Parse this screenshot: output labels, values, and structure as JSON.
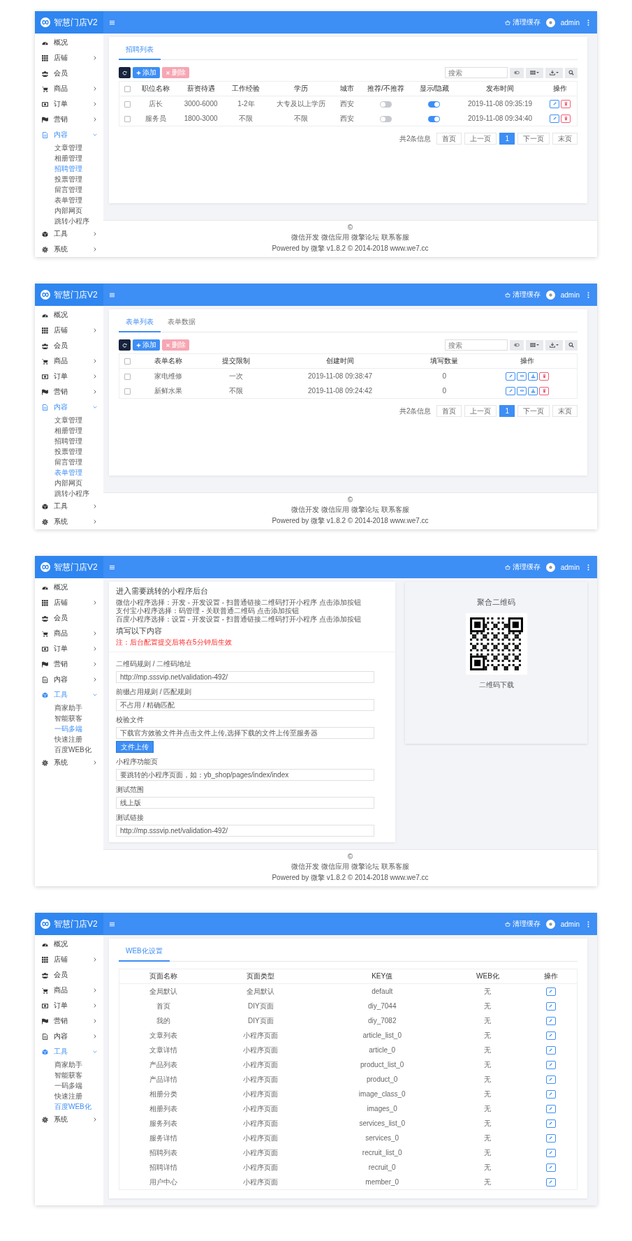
{
  "panels": [
    {
      "header": {
        "title": "智慧门店V2",
        "clear_cache": "清理缓存",
        "user": "admin"
      },
      "sidebar": [
        {
          "label": "概况",
          "kind": "link"
        },
        {
          "label": "店铺",
          "kind": "group",
          "expanded": false
        },
        {
          "label": "会员",
          "kind": "link"
        },
        {
          "label": "商品",
          "kind": "group",
          "expanded": false
        },
        {
          "label": "订单",
          "kind": "group",
          "expanded": false
        },
        {
          "label": "营销",
          "kind": "group",
          "expanded": false
        },
        {
          "label": "内容",
          "kind": "group",
          "expanded": true,
          "children": [
            {
              "label": "文章管理",
              "selected": false
            },
            {
              "label": "相册管理",
              "selected": false
            },
            {
              "label": "招聘管理",
              "selected": true
            },
            {
              "label": "投票管理",
              "selected": false
            },
            {
              "label": "留言管理",
              "selected": false
            },
            {
              "label": "表单管理",
              "selected": false
            },
            {
              "label": "内部网页",
              "selected": false
            },
            {
              "label": "跳转小程序",
              "selected": false
            }
          ]
        },
        {
          "label": "工具",
          "kind": "group",
          "expanded": false
        },
        {
          "label": "系统",
          "kind": "group",
          "expanded": false
        }
      ],
      "content": {
        "kind": "list",
        "tabs": [
          {
            "label": "招聘列表",
            "selected": true
          }
        ],
        "toolbar": {
          "buttons": [
            {
              "kind": "refresh",
              "disabled": false
            },
            {
              "kind": "add",
              "label": "添加",
              "disabled": false
            },
            {
              "kind": "delete",
              "label": "删除",
              "disabled": true
            }
          ],
          "search": {
            "placeholder": "搜索"
          },
          "tools": [
            {
              "kind": "toggle"
            },
            {
              "kind": "columns"
            },
            {
              "kind": "export"
            },
            {
              "kind": "search"
            }
          ]
        },
        "table": {
          "header_checked": false,
          "columns": [
            "职位名称",
            "薪资待遇",
            "工作经验",
            "学历",
            "城市",
            "推荐/不推荐",
            "显示/隐藏",
            "发布时间",
            "操作"
          ],
          "rows": [
            {
              "checked": false,
              "cells": [
                {
                  "kind": "text",
                  "text": "店长"
                },
                {
                  "kind": "text",
                  "text": "3000-6000"
                },
                {
                  "kind": "text",
                  "text": "1-2年"
                },
                {
                  "kind": "text",
                  "text": "大专及以上学历"
                },
                {
                  "kind": "text",
                  "text": "西安"
                },
                {
                  "kind": "toggle",
                  "on": false
                },
                {
                  "kind": "toggle",
                  "on": true
                },
                {
                  "kind": "text",
                  "text": "2019-11-08 09:35:19"
                },
                {
                  "kind": "actions",
                  "actions": [
                    {
                      "kind": "edit"
                    },
                    {
                      "kind": "delete"
                    }
                  ]
                }
              ]
            },
            {
              "checked": false,
              "cells": [
                {
                  "kind": "text",
                  "text": "服务员"
                },
                {
                  "kind": "text",
                  "text": "1800-3000"
                },
                {
                  "kind": "text",
                  "text": "不限"
                },
                {
                  "kind": "text",
                  "text": "不限"
                },
                {
                  "kind": "text",
                  "text": "西安"
                },
                {
                  "kind": "toggle",
                  "on": false
                },
                {
                  "kind": "toggle",
                  "on": true
                },
                {
                  "kind": "text",
                  "text": "2019-11-08 09:34:40"
                },
                {
                  "kind": "actions",
                  "actions": [
                    {
                      "kind": "edit"
                    },
                    {
                      "kind": "delete"
                    }
                  ]
                }
              ]
            }
          ]
        },
        "pagination": {
          "summary": "共2条信息",
          "pages": [
            {
              "label": "首页",
              "selected": false
            },
            {
              "label": "上一页",
              "selected": false
            },
            {
              "label": "1",
              "selected": true
            },
            {
              "label": "下一页",
              "selected": false
            },
            {
              "label": "末页",
              "selected": false
            }
          ]
        }
      },
      "footer": {
        "mark": "©",
        "links": [
          "微信开发",
          "微信应用",
          "微擎论坛",
          "联系客服"
        ],
        "powered": "Powered by 微擎 v1.8.2 © 2014-2018 www.we7.cc"
      }
    },
    {
      "header": {
        "title": "智慧门店V2",
        "clear_cache": "清理缓存",
        "user": "admin"
      },
      "sidebar": [
        {
          "label": "概况",
          "kind": "link"
        },
        {
          "label": "店铺",
          "kind": "group",
          "expanded": false
        },
        {
          "label": "会员",
          "kind": "link"
        },
        {
          "label": "商品",
          "kind": "group",
          "expanded": false
        },
        {
          "label": "订单",
          "kind": "group",
          "expanded": false
        },
        {
          "label": "营销",
          "kind": "group",
          "expanded": false
        },
        {
          "label": "内容",
          "kind": "group",
          "expanded": true,
          "children": [
            {
              "label": "文章管理",
              "selected": false
            },
            {
              "label": "相册管理",
              "selected": false
            },
            {
              "label": "招聘管理",
              "selected": false
            },
            {
              "label": "投票管理",
              "selected": false
            },
            {
              "label": "留言管理",
              "selected": false
            },
            {
              "label": "表单管理",
              "selected": true
            },
            {
              "label": "内部网页",
              "selected": false
            },
            {
              "label": "跳转小程序",
              "selected": false
            }
          ]
        },
        {
          "label": "工具",
          "kind": "group",
          "expanded": false
        },
        {
          "label": "系统",
          "kind": "group",
          "expanded": false
        }
      ],
      "content": {
        "kind": "list",
        "tabs": [
          {
            "label": "表单列表",
            "selected": true
          },
          {
            "label": "表单数据",
            "selected": false
          }
        ],
        "toolbar": {
          "buttons": [
            {
              "kind": "refresh",
              "disabled": false
            },
            {
              "kind": "add",
              "label": "添加",
              "disabled": false
            },
            {
              "kind": "delete",
              "label": "删除",
              "disabled": true
            }
          ],
          "search": {
            "placeholder": "搜索"
          },
          "tools": [
            {
              "kind": "toggle"
            },
            {
              "kind": "columns"
            },
            {
              "kind": "export"
            },
            {
              "kind": "search"
            }
          ]
        },
        "table": {
          "header_checked": false,
          "columns": [
            "表单名称",
            "提交限制",
            "创建时间",
            "填写数量",
            "操作"
          ],
          "rows": [
            {
              "checked": false,
              "cells": [
                {
                  "kind": "text",
                  "text": "家电维修"
                },
                {
                  "kind": "text",
                  "text": "一次"
                },
                {
                  "kind": "text",
                  "text": "2019-11-08 09:38:47"
                },
                {
                  "kind": "text",
                  "text": "0"
                },
                {
                  "kind": "actions",
                  "actions": [
                    {
                      "kind": "edit"
                    },
                    {
                      "kind": "view"
                    },
                    {
                      "kind": "download"
                    },
                    {
                      "kind": "delete"
                    }
                  ]
                }
              ]
            },
            {
              "checked": false,
              "cells": [
                {
                  "kind": "text",
                  "text": "新鲜水果"
                },
                {
                  "kind": "text",
                  "text": "不限"
                },
                {
                  "kind": "text",
                  "text": "2019-11-08 09:24:42"
                },
                {
                  "kind": "text",
                  "text": "0"
                },
                {
                  "kind": "actions",
                  "actions": [
                    {
                      "kind": "edit"
                    },
                    {
                      "kind": "view"
                    },
                    {
                      "kind": "download"
                    },
                    {
                      "kind": "delete"
                    }
                  ]
                }
              ]
            }
          ]
        },
        "pagination": {
          "summary": "共2条信息",
          "pages": [
            {
              "label": "首页",
              "selected": false
            },
            {
              "label": "上一页",
              "selected": false
            },
            {
              "label": "1",
              "selected": true
            },
            {
              "label": "下一页",
              "selected": false
            },
            {
              "label": "末页",
              "selected": false
            }
          ]
        }
      },
      "footer": {
        "mark": "©",
        "links": [
          "微信开发",
          "微信应用",
          "微擎论坛",
          "联系客服"
        ],
        "powered": "Powered by 微擎 v1.8.2 © 2014-2018 www.we7.cc"
      }
    },
    {
      "header": {
        "title": "智慧门店V2",
        "clear_cache": "清理缓存",
        "user": "admin"
      },
      "sidebar": [
        {
          "label": "概况",
          "kind": "link"
        },
        {
          "label": "店铺",
          "kind": "group",
          "expanded": false
        },
        {
          "label": "会员",
          "kind": "link"
        },
        {
          "label": "商品",
          "kind": "group",
          "expanded": false
        },
        {
          "label": "订单",
          "kind": "group",
          "expanded": false
        },
        {
          "label": "营销",
          "kind": "group",
          "expanded": false
        },
        {
          "label": "内容",
          "kind": "group",
          "expanded": false
        },
        {
          "label": "工具",
          "kind": "group",
          "expanded": true,
          "children": [
            {
              "label": "商家助手",
              "selected": false
            },
            {
              "label": "智能获客",
              "selected": false
            },
            {
              "label": "一码多端",
              "selected": true
            },
            {
              "label": "快速注册",
              "selected": false
            },
            {
              "label": "百度WEB化",
              "selected": false
            }
          ]
        },
        {
          "label": "系统",
          "kind": "group",
          "expanded": false
        }
      ],
      "content": {
        "kind": "form",
        "intro": {
          "title": "进入需要跳转的小程序后台",
          "steps": [
            "微信小程序选择：开发 - 开发设置 - 扫普通链接二维码打开小程序 点击添加按钮",
            "支付宝小程序选择：码管理 - 关联普通二维码 点击添加按钮",
            "百度小程序选择：设置 - 开发设置 - 扫普通链接二维码打开小程序 点击添加按钮"
          ],
          "subtitle": "填写以下内容",
          "note": "注：后台配置提交后将在5分钟后生效"
        },
        "fields": [
          {
            "label": "二维码规则 / 二维码地址",
            "value": "http://mp.sssvip.net/validation-492/"
          },
          {
            "label": "前缀占用规则 / 匹配规则",
            "value": "不占用 / 精确匹配"
          },
          {
            "label": "校验文件",
            "value": "下载官方效验文件并点击文件上传,选择下载的文件上传至服务器",
            "button": "文件上传"
          },
          {
            "label": "小程序功能页",
            "value": "要跳转的小程序页面，如：yb_shop/pages/index/index"
          },
          {
            "label": "测试范围",
            "value": "线上版"
          },
          {
            "label": "测试链接",
            "value": "http://mp.sssvip.net/validation-492/"
          }
        ],
        "qr": {
          "title": "聚合二维码",
          "caption": "二维码下载"
        }
      },
      "footer": {
        "mark": "©",
        "links": [
          "微信开发",
          "微信应用",
          "微擎论坛",
          "联系客服"
        ],
        "powered": "Powered by 微擎 v1.8.2 © 2014-2018 www.we7.cc"
      }
    },
    {
      "header": {
        "title": "智慧门店V2",
        "clear_cache": "清理缓存",
        "user": "admin"
      },
      "sidebar": [
        {
          "label": "概况",
          "kind": "link"
        },
        {
          "label": "店铺",
          "kind": "group",
          "expanded": false
        },
        {
          "label": "会员",
          "kind": "link"
        },
        {
          "label": "商品",
          "kind": "group",
          "expanded": false
        },
        {
          "label": "订单",
          "kind": "group",
          "expanded": false
        },
        {
          "label": "营销",
          "kind": "group",
          "expanded": false
        },
        {
          "label": "内容",
          "kind": "group",
          "expanded": false
        },
        {
          "label": "工具",
          "kind": "group",
          "expanded": true,
          "children": [
            {
              "label": "商家助手",
              "selected": false
            },
            {
              "label": "智能获客",
              "selected": false
            },
            {
              "label": "一码多端",
              "selected": false
            },
            {
              "label": "快速注册",
              "selected": false
            },
            {
              "label": "百度WEB化",
              "selected": true
            }
          ]
        },
        {
          "label": "系统",
          "kind": "group",
          "expanded": false
        }
      ],
      "content": {
        "kind": "list",
        "tabs": [
          {
            "label": "WEB化设置",
            "selected": true
          }
        ],
        "table": {
          "columns": [
            "页面名称",
            "页面类型",
            "KEY值",
            "WEB化",
            "操作"
          ],
          "rows": [
            {
              "cells": [
                {
                  "kind": "text",
                  "text": "全局默认"
                },
                {
                  "kind": "text",
                  "text": "全局默认"
                },
                {
                  "kind": "text",
                  "text": "default"
                },
                {
                  "kind": "text",
                  "text": "无"
                },
                {
                  "kind": "actions",
                  "actions": [
                    {
                      "kind": "edit"
                    }
                  ]
                }
              ]
            },
            {
              "cells": [
                {
                  "kind": "text",
                  "text": "首页"
                },
                {
                  "kind": "text",
                  "text": "DIY页面"
                },
                {
                  "kind": "text",
                  "text": "diy_7044"
                },
                {
                  "kind": "text",
                  "text": "无"
                },
                {
                  "kind": "actions",
                  "actions": [
                    {
                      "kind": "edit"
                    }
                  ]
                }
              ]
            },
            {
              "cells": [
                {
                  "kind": "text",
                  "text": "我的"
                },
                {
                  "kind": "text",
                  "text": "DIY页面"
                },
                {
                  "kind": "text",
                  "text": "diy_7082"
                },
                {
                  "kind": "text",
                  "text": "无"
                },
                {
                  "kind": "actions",
                  "actions": [
                    {
                      "kind": "edit"
                    }
                  ]
                }
              ]
            },
            {
              "cells": [
                {
                  "kind": "text",
                  "text": "文章列表"
                },
                {
                  "kind": "text",
                  "text": "小程序页面"
                },
                {
                  "kind": "text",
                  "text": "article_list_0"
                },
                {
                  "kind": "text",
                  "text": "无"
                },
                {
                  "kind": "actions",
                  "actions": [
                    {
                      "kind": "edit"
                    }
                  ]
                }
              ]
            },
            {
              "cells": [
                {
                  "kind": "text",
                  "text": "文章详情"
                },
                {
                  "kind": "text",
                  "text": "小程序页面"
                },
                {
                  "kind": "text",
                  "text": "article_0"
                },
                {
                  "kind": "text",
                  "text": "无"
                },
                {
                  "kind": "actions",
                  "actions": [
                    {
                      "kind": "edit"
                    }
                  ]
                }
              ]
            },
            {
              "cells": [
                {
                  "kind": "text",
                  "text": "产品列表"
                },
                {
                  "kind": "text",
                  "text": "小程序页面"
                },
                {
                  "kind": "text",
                  "text": "product_list_0"
                },
                {
                  "kind": "text",
                  "text": "无"
                },
                {
                  "kind": "actions",
                  "actions": [
                    {
                      "kind": "edit"
                    }
                  ]
                }
              ]
            },
            {
              "cells": [
                {
                  "kind": "text",
                  "text": "产品详情"
                },
                {
                  "kind": "text",
                  "text": "小程序页面"
                },
                {
                  "kind": "text",
                  "text": "product_0"
                },
                {
                  "kind": "text",
                  "text": "无"
                },
                {
                  "kind": "actions",
                  "actions": [
                    {
                      "kind": "edit"
                    }
                  ]
                }
              ]
            },
            {
              "cells": [
                {
                  "kind": "text",
                  "text": "相册分类"
                },
                {
                  "kind": "text",
                  "text": "小程序页面"
                },
                {
                  "kind": "text",
                  "text": "image_class_0"
                },
                {
                  "kind": "text",
                  "text": "无"
                },
                {
                  "kind": "actions",
                  "actions": [
                    {
                      "kind": "edit"
                    }
                  ]
                }
              ]
            },
            {
              "cells": [
                {
                  "kind": "text",
                  "text": "相册列表"
                },
                {
                  "kind": "text",
                  "text": "小程序页面"
                },
                {
                  "kind": "text",
                  "text": "images_0"
                },
                {
                  "kind": "text",
                  "text": "无"
                },
                {
                  "kind": "actions",
                  "actions": [
                    {
                      "kind": "edit"
                    }
                  ]
                }
              ]
            },
            {
              "cells": [
                {
                  "kind": "text",
                  "text": "服务列表"
                },
                {
                  "kind": "text",
                  "text": "小程序页面"
                },
                {
                  "kind": "text",
                  "text": "services_list_0"
                },
                {
                  "kind": "text",
                  "text": "无"
                },
                {
                  "kind": "actions",
                  "actions": [
                    {
                      "kind": "edit"
                    }
                  ]
                }
              ]
            },
            {
              "cells": [
                {
                  "kind": "text",
                  "text": "服务详情"
                },
                {
                  "kind": "text",
                  "text": "小程序页面"
                },
                {
                  "kind": "text",
                  "text": "services_0"
                },
                {
                  "kind": "text",
                  "text": "无"
                },
                {
                  "kind": "actions",
                  "actions": [
                    {
                      "kind": "edit"
                    }
                  ]
                }
              ]
            },
            {
              "cells": [
                {
                  "kind": "text",
                  "text": "招聘列表"
                },
                {
                  "kind": "text",
                  "text": "小程序页面"
                },
                {
                  "kind": "text",
                  "text": "recruit_list_0"
                },
                {
                  "kind": "text",
                  "text": "无"
                },
                {
                  "kind": "actions",
                  "actions": [
                    {
                      "kind": "edit"
                    }
                  ]
                }
              ]
            },
            {
              "cells": [
                {
                  "kind": "text",
                  "text": "招聘详情"
                },
                {
                  "kind": "text",
                  "text": "小程序页面"
                },
                {
                  "kind": "text",
                  "text": "recruit_0"
                },
                {
                  "kind": "text",
                  "text": "无"
                },
                {
                  "kind": "actions",
                  "actions": [
                    {
                      "kind": "edit"
                    }
                  ]
                }
              ]
            },
            {
              "cells": [
                {
                  "kind": "text",
                  "text": "用户中心"
                },
                {
                  "kind": "text",
                  "text": "小程序页面"
                },
                {
                  "kind": "text",
                  "text": "member_0"
                },
                {
                  "kind": "text",
                  "text": "无"
                },
                {
                  "kind": "actions",
                  "actions": [
                    {
                      "kind": "edit"
                    }
                  ]
                }
              ]
            }
          ]
        }
      }
    }
  ]
}
